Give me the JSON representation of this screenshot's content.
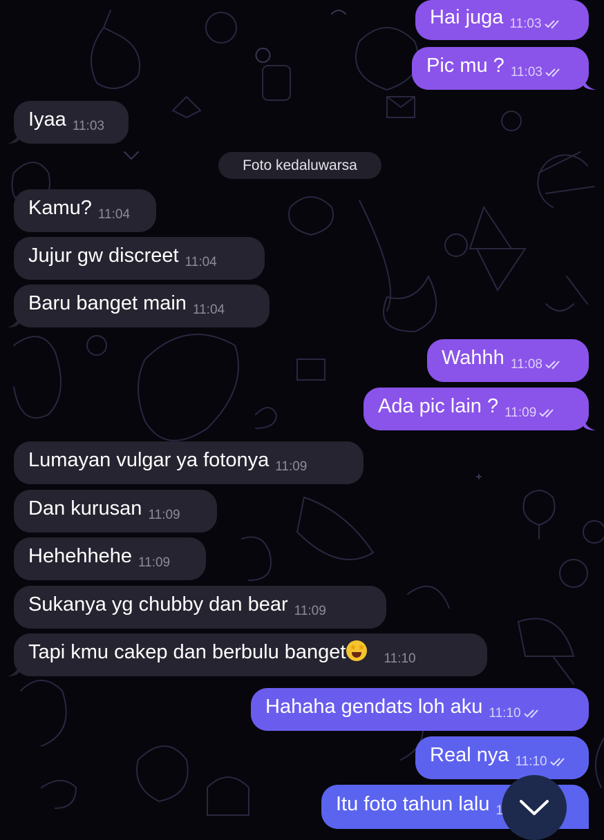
{
  "colors": {
    "background": "#07060c",
    "incoming_bubble": "#252430",
    "outgoing_bubble": "#8a53ea",
    "outgoing_bubble_bottom": "#5a64ee",
    "scroll_button": "#1d2a4d"
  },
  "service_message": "Foto kedaluwarsa",
  "messages": [
    {
      "direction": "out",
      "text": "Hai juga",
      "time": "11:03",
      "status": "read"
    },
    {
      "direction": "out",
      "text": "Pic mu ?",
      "time": "11:03",
      "status": "read"
    },
    {
      "direction": "in",
      "text": "Iyaa",
      "time": "11:03"
    },
    {
      "direction": "in",
      "text": "Kamu?",
      "time": "11:04"
    },
    {
      "direction": "in",
      "text": "Jujur gw discreet",
      "time": "11:04"
    },
    {
      "direction": "in",
      "text": "Baru banget main",
      "time": "11:04"
    },
    {
      "direction": "out",
      "text": "Wahhh",
      "time": "11:08",
      "status": "read"
    },
    {
      "direction": "out",
      "text": "Ada pic lain ?",
      "time": "11:09",
      "status": "read"
    },
    {
      "direction": "in",
      "text": "Lumayan vulgar ya fotonya",
      "time": "11:09"
    },
    {
      "direction": "in",
      "text": "Dan kurusan",
      "time": "11:09"
    },
    {
      "direction": "in",
      "text": "Hehehhehe",
      "time": "11:09"
    },
    {
      "direction": "in",
      "text": "Sukanya yg chubby dan bear",
      "time": "11:09"
    },
    {
      "direction": "in",
      "text": "Tapi kmu cakep dan berbulu banget",
      "emoji": "star-struck-emoji",
      "time": "11:10"
    },
    {
      "direction": "out",
      "text": "Hahaha gendats loh aku",
      "time": "11:10",
      "status": "read"
    },
    {
      "direction": "out",
      "text": "Real nya",
      "time": "11:10",
      "status": "read"
    },
    {
      "direction": "out",
      "text": "Itu foto tahun lalu",
      "time": "11:10",
      "status": "read"
    }
  ],
  "scroll_button_icon": "chevron-down-icon"
}
